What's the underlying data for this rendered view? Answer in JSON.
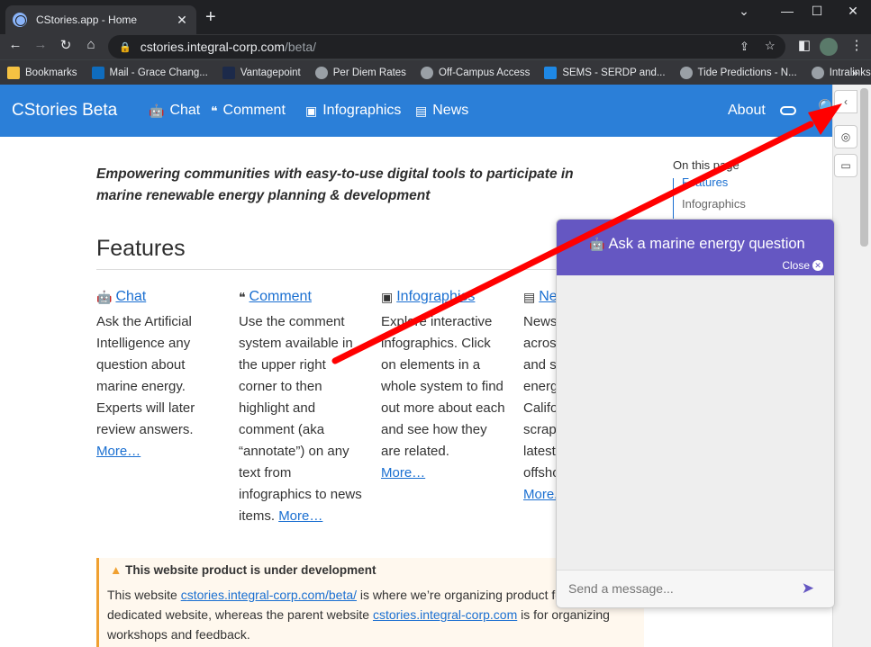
{
  "browser": {
    "tab_title": "CStories.app - Home",
    "tab_close": "✕",
    "new_tab": "+",
    "url_host": "cstories.integral-corp.com",
    "url_path": "/beta/",
    "window_controls": [
      "⌄",
      "—",
      "☐",
      "✕"
    ]
  },
  "bookmarks": [
    {
      "label": "Bookmarks",
      "color": "#f5c242"
    },
    {
      "label": "Mail - Grace Chang...",
      "color": "#0f6cbd"
    },
    {
      "label": "Vantagepoint",
      "color": "#1c2a4a"
    },
    {
      "label": "Per Diem Rates",
      "color": "#9aa0a6"
    },
    {
      "label": "Off-Campus Access",
      "color": "#9aa0a6"
    },
    {
      "label": "SEMS - SERDP and...",
      "color": "#1e88e5"
    },
    {
      "label": "Tide Predictions - N...",
      "color": "#9aa0a6"
    },
    {
      "label": "Intralinks VIA",
      "color": "#9aa0a6"
    }
  ],
  "bookmarks_more": "»",
  "site": {
    "brand": "CStories Beta",
    "nav": [
      "Chat",
      "Comment",
      "Infographics",
      "News"
    ],
    "about": "About"
  },
  "main": {
    "lead": "Empowering communities with easy-to-use digital tools to participate in marine renewable energy planning & development",
    "features_title": "Features",
    "features": [
      {
        "title": "Chat",
        "body": "Ask the Artificial Intelligence any question about marine energy. Experts will later review answers.",
        "more": "More…"
      },
      {
        "title": "Comment",
        "body": "Use the comment system available in the upper right corner to then highlight and comment (aka “annotate”) on any text from infographics to news items.",
        "more": "More…"
      },
      {
        "title": "Infographics",
        "body": "Explore interactive infographics. Click on elements in a whole system to find out more about each and see how they are related.",
        "more": "More…"
      },
      {
        "title": "Ne",
        "body": "News across and s energ Califo scrap latest offsho",
        "more": "More."
      }
    ],
    "toc_title": "On this page",
    "toc_items": [
      "Features",
      "Infographics"
    ],
    "warning_title": "This website product is under development",
    "warning_text_1": "This website ",
    "warning_link_1": "stories.integral-corp.com/beta/",
    "warning_link_1_prefix": "c",
    "warning_text_2": " is where we’re organizing product feat",
    "warning_text_3": "dedicated website, whereas the parent website ",
    "warning_link_2": "cstories.integral-corp.com",
    "warning_text_4": " is for organizing",
    "warning_text_5": "workshops and feedback."
  },
  "chat": {
    "title": "Ask a marine energy question",
    "close": "Close",
    "placeholder": "Send a message..."
  },
  "colors": {
    "site_nav": "#2b7fd8",
    "chat_header": "#6557c2",
    "arrow": "#ff0000",
    "warning_border": "#f0a030"
  }
}
